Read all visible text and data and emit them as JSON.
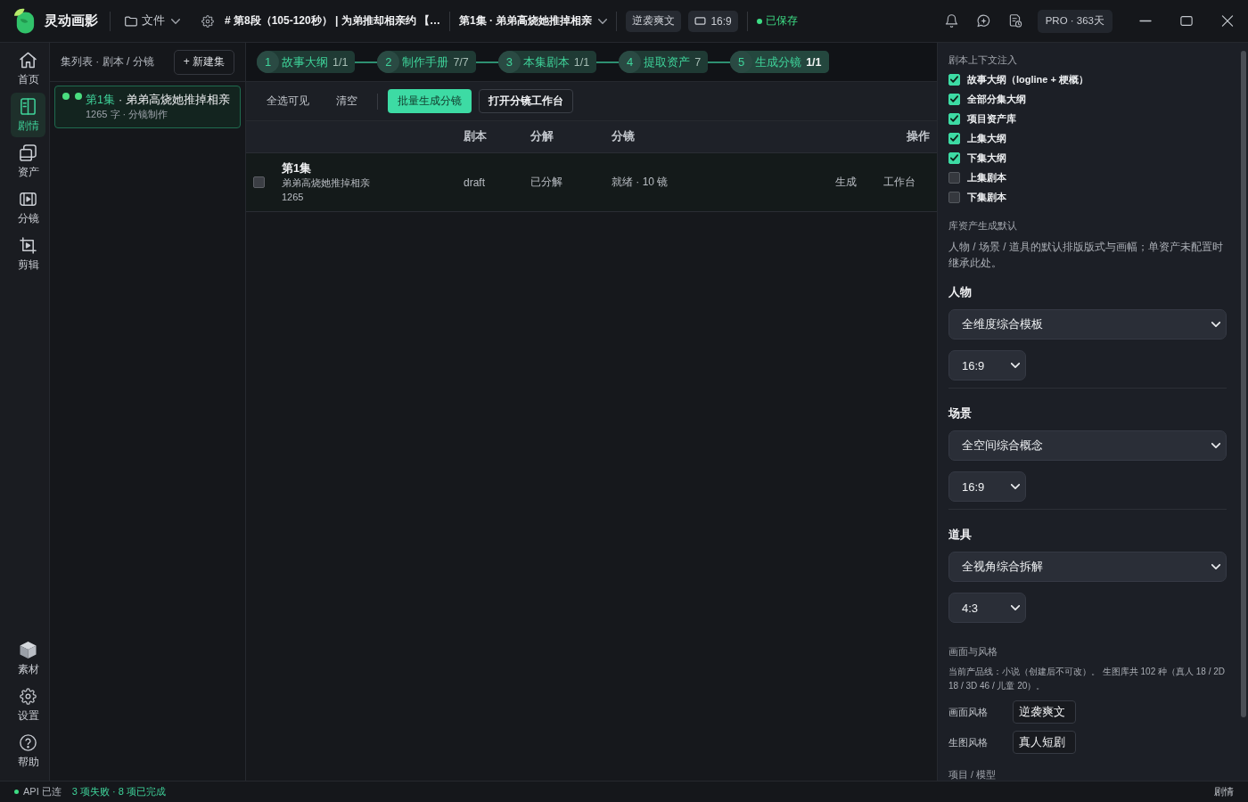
{
  "top_bar": {
    "app_name": "灵动画影",
    "file_menu": "文件",
    "segment_title": "# 第8段（105-120秒） | 为弟推却相亲约 【…",
    "episode_picker": "第1集 · 弟弟高烧她推掉相亲",
    "genre_tag": "逆袭爽文",
    "ratio_tag": "16:9",
    "save_status": "已保存",
    "plan_badge": "PRO · 363天"
  },
  "nav": {
    "items": [
      {
        "label": "首页",
        "selected": false
      },
      {
        "label": "剧情",
        "selected": true
      },
      {
        "label": "资产",
        "selected": false
      },
      {
        "label": "分镜",
        "selected": false
      },
      {
        "label": "剪辑",
        "selected": false
      }
    ],
    "bottom_items": [
      {
        "label": "素材",
        "selected": false
      },
      {
        "label": "设置",
        "selected": false
      },
      {
        "label": "帮助",
        "selected": false
      }
    ]
  },
  "episode_list": {
    "title": "集列表 · 剧本 / 分镜",
    "new_button": "+ 新建集",
    "items": [
      {
        "number": "第1集",
        "title": "· 弟弟高烧她推掉相亲",
        "meta": "1265 字 · 分镜制作",
        "selected": true,
        "status_dots": [
          {
            "color": "#4ade80"
          },
          {
            "color": "#4ade80"
          }
        ]
      }
    ]
  },
  "steps": [
    {
      "number": "1",
      "label": "故事大纲",
      "count": "1/1",
      "selected": false
    },
    {
      "number": "2",
      "label": "制作手册",
      "count": "7/7",
      "selected": false
    },
    {
      "number": "3",
      "label": "本集剧本",
      "count": "1/1",
      "selected": false
    },
    {
      "number": "4",
      "label": "提取资产",
      "count": "7",
      "selected": false
    },
    {
      "number": "5",
      "label": "生成分镜",
      "count": "1/1",
      "selected": true
    }
  ],
  "toolbar": {
    "buttons": [
      {
        "label": "全选可见",
        "kind": "text"
      },
      {
        "label": "清空",
        "kind": "text"
      },
      {
        "label": "批量生成分镜",
        "kind": "primary"
      },
      {
        "label": "打开分镜工作台",
        "kind": "outline"
      }
    ]
  },
  "table": {
    "columns": [
      "剧本",
      "分解",
      "分镜",
      "操作"
    ],
    "rows": [
      {
        "checked": false,
        "episode": "第1集",
        "title": "弟弟高烧她推掉相亲",
        "word_count": "1265",
        "script": "draft",
        "breakdown": "已分解",
        "storyboard": "就绪 · 10 镜",
        "actions": [
          "生成",
          "工作台"
        ]
      }
    ]
  },
  "side_panel": {
    "context": {
      "title": "剧本上下文注入",
      "options": [
        {
          "label": "故事大纲（logline + 梗概）",
          "checked": true
        },
        {
          "label": "全部分集大纲",
          "checked": true
        },
        {
          "label": "项目资产库",
          "checked": true
        },
        {
          "label": "上集大纲",
          "checked": true
        },
        {
          "label": "下集大纲",
          "checked": true
        },
        {
          "label": "上集剧本",
          "checked": false
        },
        {
          "label": "下集剧本",
          "checked": false
        }
      ]
    },
    "asset_defaults": {
      "title": "库资产生成默认",
      "description": "人物 / 场景 / 道具的默认排版版式与画幅；单资产未配置时继承此处。",
      "groups": [
        {
          "label": "人物",
          "template": "全维度综合模板",
          "ratio": "16:9"
        },
        {
          "label": "场景",
          "template": "全空间综合概念",
          "ratio": "16:9"
        },
        {
          "label": "道具",
          "template": "全视角综合拆解",
          "ratio": "4:3"
        }
      ]
    },
    "style": {
      "title": "画面与风格",
      "note": "当前产品线：小说（创建后不可改）。 生图库共 102 种（真人 18 / 2D 18 / 3D 46 / 儿童 20）。",
      "fields": [
        {
          "label": "画面风格",
          "value": "逆袭爽文"
        },
        {
          "label": "生图风格",
          "value": "真人短剧"
        }
      ]
    },
    "model_section": {
      "title": "项目 / 模型"
    }
  },
  "status_bar": {
    "api": {
      "label": "API 已连",
      "connected": true
    },
    "task_summary": "3 项失败 · 8 项已完成",
    "current_view": "剧情"
  }
}
